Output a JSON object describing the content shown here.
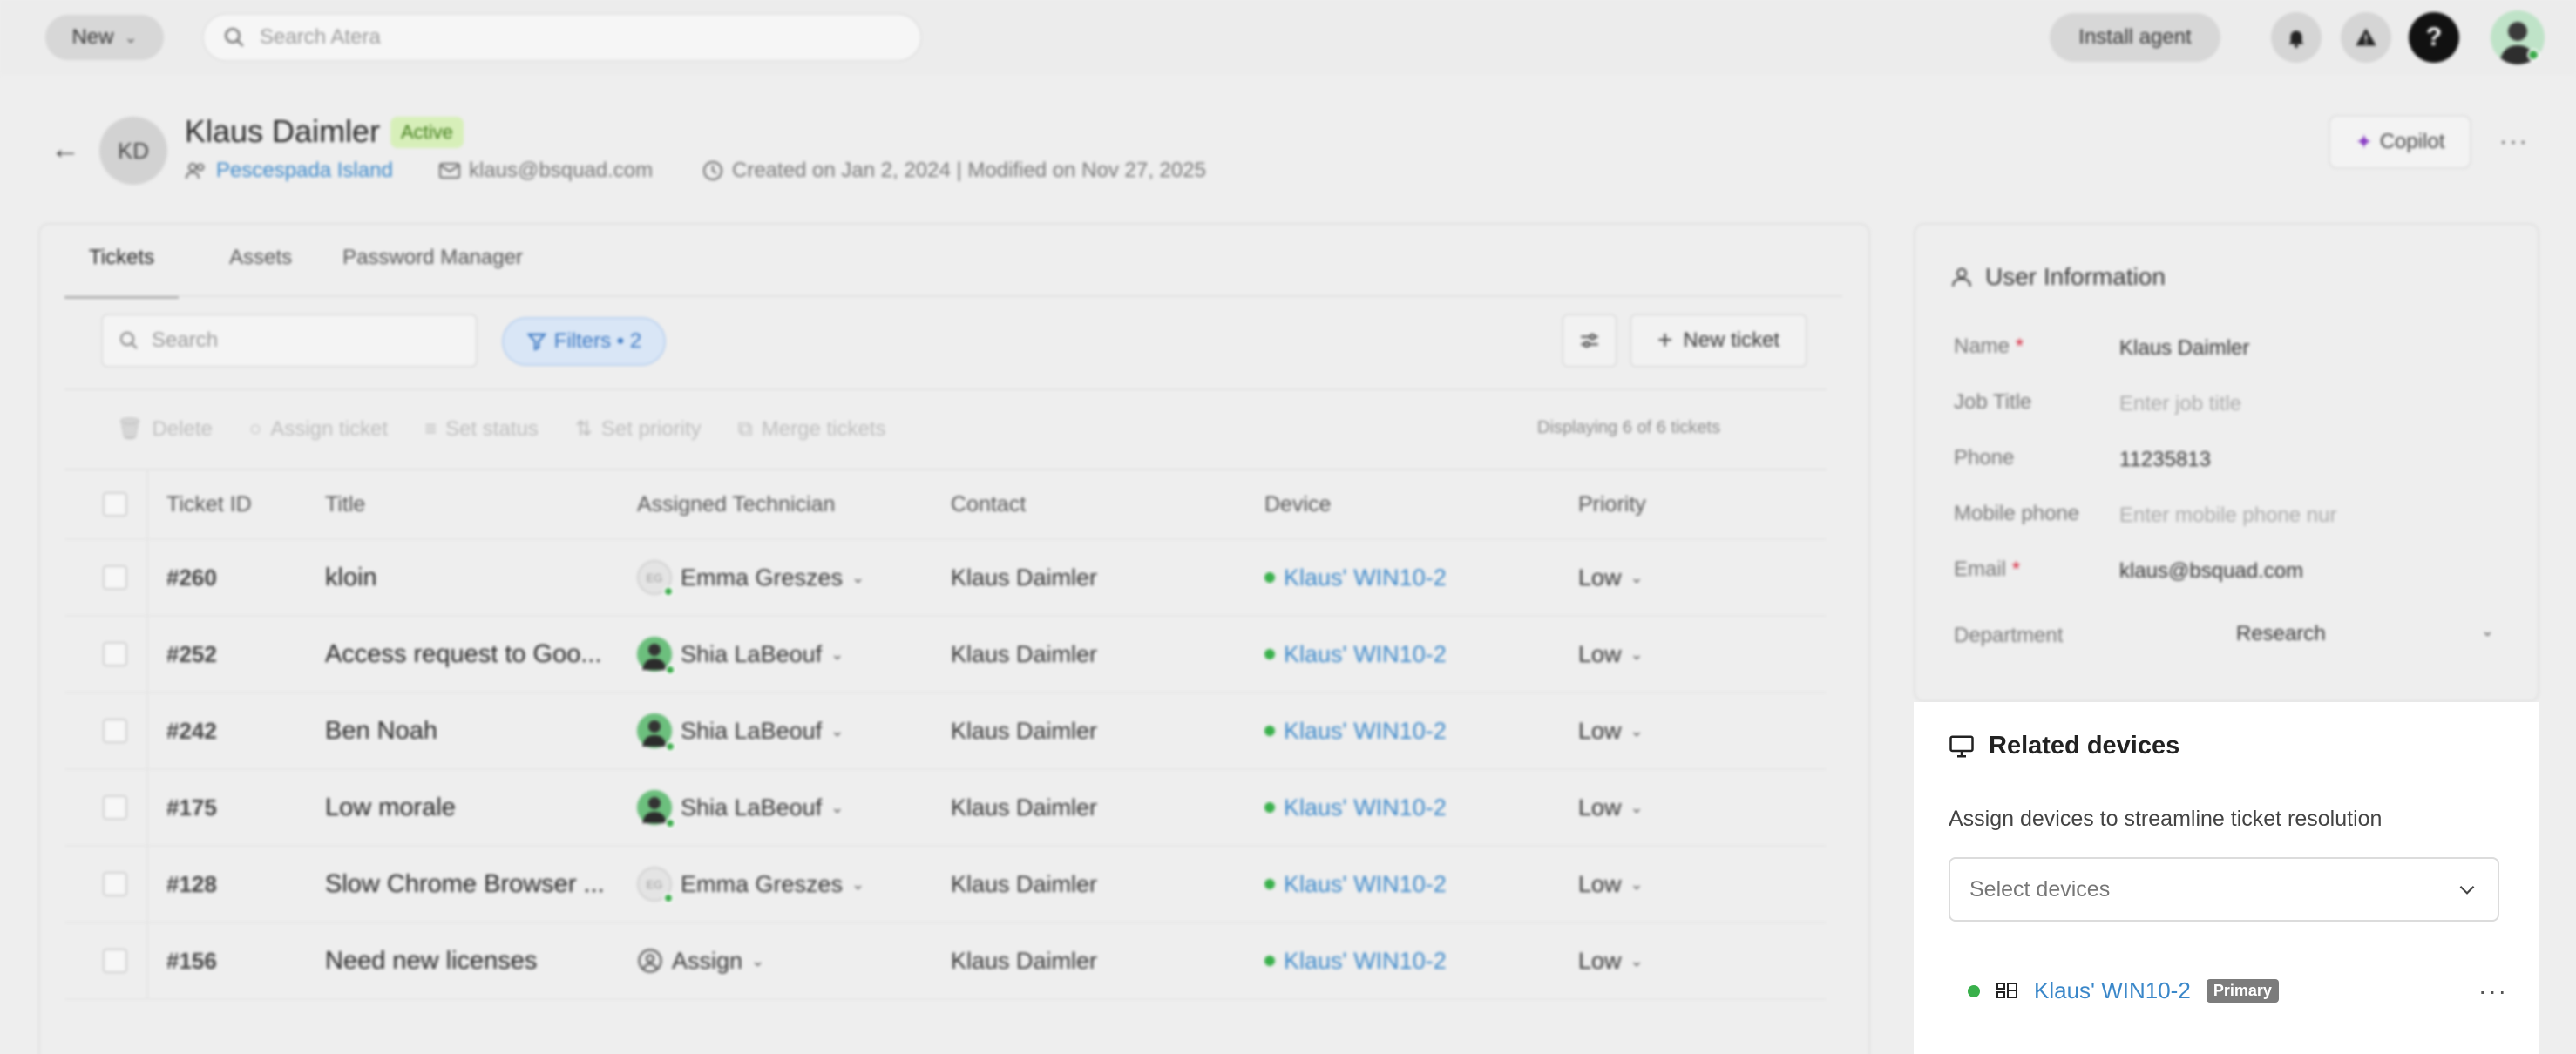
{
  "topbar": {
    "new_label": "New",
    "search_placeholder": "Search Atera",
    "install_label": "Install agent",
    "help_label": "?"
  },
  "user": {
    "initials": "KD",
    "name": "Klaus Daimler",
    "status": "Active",
    "customer": "Pescespada Island",
    "email": "klaus@bsquad.com",
    "created": "Created on Jan 2, 2024 | Modified on Nov 27, 2025",
    "copilot_label": "Copilot"
  },
  "tabs": [
    {
      "label": "Tickets",
      "active": true
    },
    {
      "label": "Assets",
      "active": false
    },
    {
      "label": "Password Manager",
      "active": false
    }
  ],
  "toolbar": {
    "search_placeholder": "Search",
    "filters_label": "Filters • 2",
    "new_ticket_label": "New ticket"
  },
  "bulk_actions": {
    "delete": "Delete",
    "assign": "Assign ticket",
    "status": "Set status",
    "priority": "Set priority",
    "merge": "Merge tickets",
    "display_count": "Displaying 6 of 6 tickets"
  },
  "table": {
    "columns": {
      "id": "Ticket ID",
      "title": "Title",
      "tech": "Assigned Technician",
      "contact": "Contact",
      "device": "Device",
      "priority": "Priority"
    },
    "rows": [
      {
        "id": "#260",
        "title": "kloin",
        "tech": "Emma Greszes",
        "tech_initials": "EG",
        "tech_type": "initials",
        "contact": "Klaus Daimler",
        "device": "Klaus' WIN10-2",
        "priority": "Low"
      },
      {
        "id": "#252",
        "title": "Access request to Goo...",
        "tech": "Shia LaBeouf",
        "tech_initials": "",
        "tech_type": "photo",
        "contact": "Klaus Daimler",
        "device": "Klaus' WIN10-2",
        "priority": "Low"
      },
      {
        "id": "#242",
        "title": "Ben Noah",
        "tech": "Shia LaBeouf",
        "tech_initials": "",
        "tech_type": "photo",
        "contact": "Klaus Daimler",
        "device": "Klaus' WIN10-2",
        "priority": "Low"
      },
      {
        "id": "#175",
        "title": "Low morale",
        "tech": "Shia LaBeouf",
        "tech_initials": "",
        "tech_type": "photo",
        "contact": "Klaus Daimler",
        "device": "Klaus' WIN10-2",
        "priority": "Low"
      },
      {
        "id": "#128",
        "title": "Slow Chrome Browser ...",
        "tech": "Emma Greszes",
        "tech_initials": "EG",
        "tech_type": "initials",
        "contact": "Klaus Daimler",
        "device": "Klaus' WIN10-2",
        "priority": "Low"
      },
      {
        "id": "#156",
        "title": "Need new licenses",
        "tech": "Assign",
        "tech_initials": "",
        "tech_type": "assign",
        "contact": "Klaus Daimler",
        "device": "Klaus' WIN10-2",
        "priority": "Low"
      }
    ]
  },
  "user_info": {
    "title": "User Information",
    "fields": {
      "name_label": "Name",
      "name_value": "Klaus Daimler",
      "job_label": "Job Title",
      "job_placeholder": "Enter job title",
      "phone_label": "Phone",
      "phone_value": "11235813",
      "mobile_label": "Mobile phone",
      "mobile_placeholder": "Enter mobile phone nur",
      "email_label": "Email",
      "email_value": "klaus@bsquad.com",
      "dept_label": "Department",
      "dept_value": "Research"
    }
  },
  "related_devices": {
    "title": "Related devices",
    "subtitle": "Assign devices to streamline ticket resolution",
    "select_placeholder": "Select devices",
    "device_name": "Klaus' WIN10-2",
    "primary_label": "Primary"
  },
  "colors": {
    "link": "#3a87c9",
    "online": "#39b04b",
    "active_badge_bg": "#d7efb9",
    "filter_pill_bg": "#d9e6f6",
    "required": "#d7263d"
  }
}
